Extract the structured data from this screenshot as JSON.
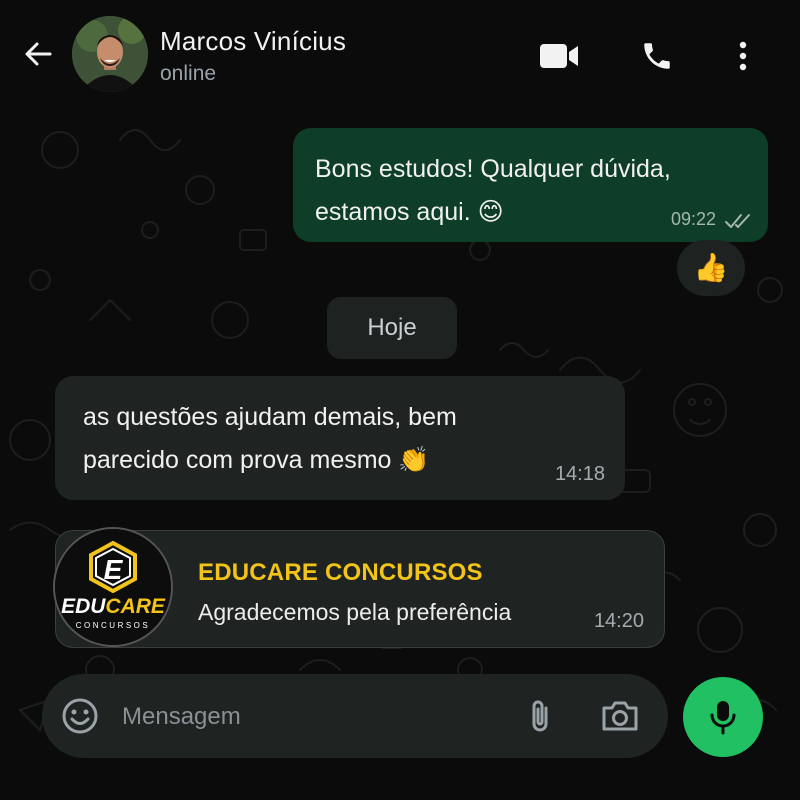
{
  "header": {
    "contact_name": "Marcos Vinícius",
    "status": "online",
    "icons": {
      "back": "arrow-left-icon",
      "video": "video-camera-icon",
      "call": "phone-icon",
      "menu": "more-vertical-icon"
    }
  },
  "messages": {
    "outgoing": {
      "text_line1": "Bons estudos! Qualquer dúvida,",
      "text_line2": "estamos aqui. 😊",
      "time": "09:22",
      "status_icon": "double-check-icon",
      "reaction": "👍"
    },
    "date_divider": "Hoje",
    "incoming": {
      "text_line1": "as questões ajudam demais, bem",
      "text_line2": "parecido com prova mesmo 👏",
      "time": "14:18"
    },
    "card": {
      "logo_letter": "E",
      "logo_word_white": "EDU",
      "logo_word_yellow": "CARE",
      "logo_sub": "CONCURSOS",
      "title": "EDUCARE CONCURSOS",
      "subtitle": "Agradecemos pela preferência",
      "time": "14:20"
    }
  },
  "composer": {
    "placeholder": "Mensagem",
    "icons": {
      "emoji": "emoji-icon",
      "attach": "paperclip-icon",
      "camera": "camera-icon",
      "mic": "microphone-icon"
    }
  },
  "colors": {
    "background": "#0b0b0b",
    "outgoing_bubble": "#0e3d28",
    "incoming_bubble": "#1f2321",
    "accent_green": "#21c063",
    "brand_yellow": "#f2c319"
  }
}
